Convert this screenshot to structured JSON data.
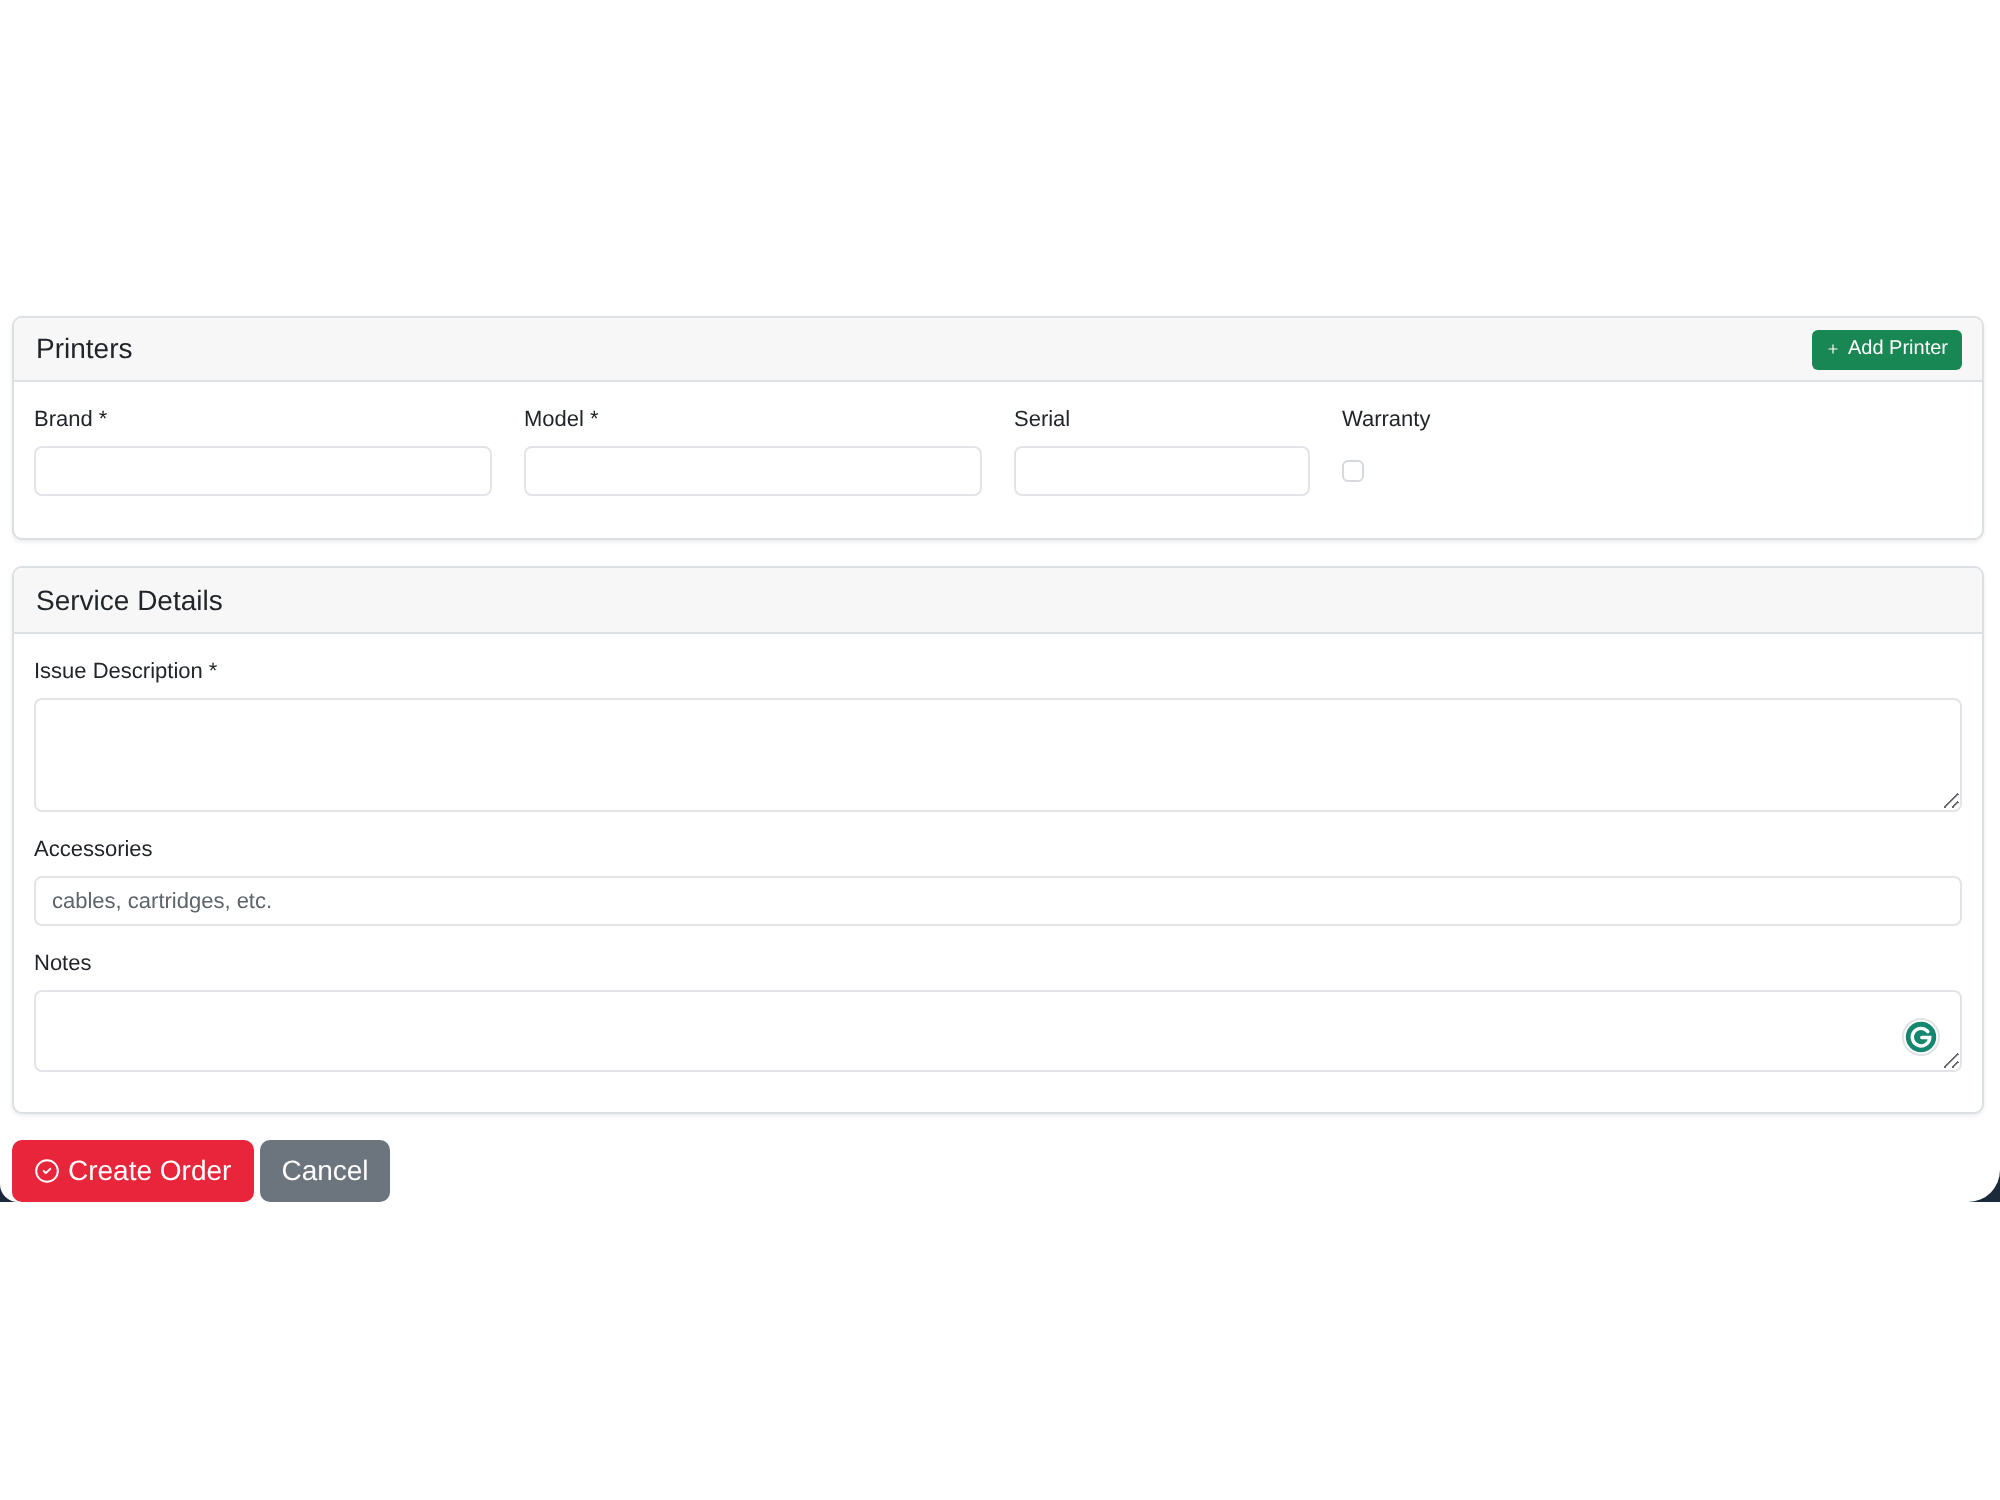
{
  "printers_card": {
    "title": "Printers",
    "add_button": {
      "label": "Add Printer"
    },
    "fields": [
      {
        "kind": "text",
        "label": "Brand *"
      },
      {
        "kind": "text",
        "label": "Model *"
      },
      {
        "kind": "text",
        "label": "Serial"
      },
      {
        "kind": "checkbox",
        "label": "Warranty",
        "checked": false
      }
    ]
  },
  "service_card": {
    "title": "Service Details",
    "fields": [
      {
        "kind": "textarea",
        "label": "Issue Description *"
      },
      {
        "kind": "input",
        "label": "Accessories",
        "placeholder": "cables, cartridges, etc."
      },
      {
        "kind": "textarea",
        "label": "Notes"
      }
    ]
  },
  "actions": [
    {
      "kind": "primary",
      "label": "Create Order"
    },
    {
      "kind": "secondary",
      "label": "Cancel"
    }
  ]
}
